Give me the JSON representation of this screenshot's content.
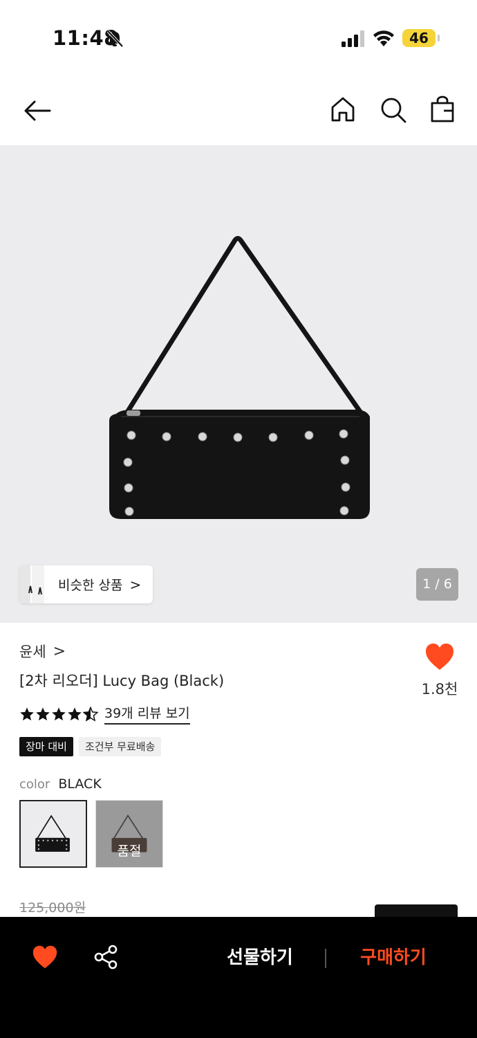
{
  "status_bar": {
    "time": "11:48",
    "battery": "46",
    "battery_color": "#f5d43a"
  },
  "nav": {
    "back_icon": "arrow-left-icon",
    "home_icon": "home-icon",
    "search_icon": "search-icon",
    "bag_icon": "shopping-bag-icon"
  },
  "gallery": {
    "similar_label": "비슷한 상품",
    "similar_chevron": ">",
    "page_indicator": "1 / 6",
    "background_color": "#ececee"
  },
  "product": {
    "brand": "윤세",
    "brand_chevron": ">",
    "title": "[2차 리오더] Lucy Bag (Black)",
    "like_count": "1.8천",
    "like_color": "#ff4b1f",
    "rating": 4.5,
    "review_link": "39개 리뷰 보기",
    "badges": [
      "장마 대비",
      "조건부 무료배송"
    ],
    "color_label": "color",
    "color_value": "BLACK",
    "soldout_label": "품절",
    "original_price": "125,000원"
  },
  "bottom_bar": {
    "heart_icon": "heart-icon",
    "share_icon": "share-icon",
    "gift_label": "선물하기",
    "buy_label": "구매하기",
    "buy_color": "#ff4b1f"
  }
}
